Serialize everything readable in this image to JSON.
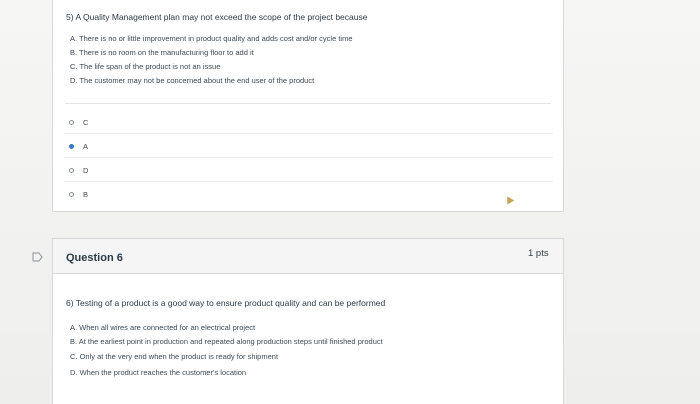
{
  "question5": {
    "prompt": "5) A Quality Management plan may not exceed the scope of the project because",
    "options": [
      "A. There is no or little improvement in product quality and adds cost and/or cycle time",
      "B. There is no room on the manufacturing floor to add it",
      "C. The life span of the product is not an issue",
      "D. The customer may not be concerned about the end user of the product"
    ],
    "answers": [
      {
        "label": "C",
        "selected": false
      },
      {
        "label": "A",
        "selected": true
      },
      {
        "label": "D",
        "selected": false
      },
      {
        "label": "B",
        "selected": false
      }
    ]
  },
  "question6": {
    "title": "Question 6",
    "points": "1 pts",
    "prompt": "6) Testing of a product is a good way to ensure product quality and can be performed",
    "options": [
      "A. When all wires are connected for an electrical project",
      "B. At the earliest point in production and repeated along production steps until finished product",
      "C. Only at the very end when the product is ready for shipment",
      "D. When the product reaches the customer's location"
    ]
  },
  "colors": {
    "selected_radio": "#1f5ea8",
    "text": "#2d3b45",
    "border": "#d6d8da"
  }
}
